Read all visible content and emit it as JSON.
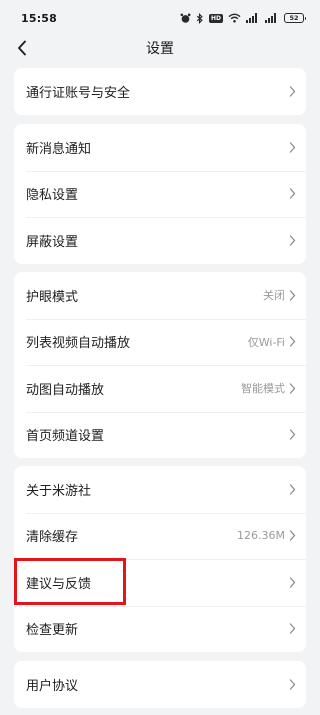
{
  "status_bar": {
    "time": "15:58",
    "hd_badge": "HD",
    "battery": "52"
  },
  "nav": {
    "title": "设置"
  },
  "groups": [
    {
      "items": [
        {
          "label": "通行证账号与安全",
          "value": ""
        }
      ]
    },
    {
      "items": [
        {
          "label": "新消息通知",
          "value": ""
        },
        {
          "label": "隐私设置",
          "value": ""
        },
        {
          "label": "屏蔽设置",
          "value": ""
        }
      ]
    },
    {
      "items": [
        {
          "label": "护眼模式",
          "value": "关闭"
        },
        {
          "label": "列表视频自动播放",
          "value": "仅Wi-Fi"
        },
        {
          "label": "动图自动播放",
          "value": "智能模式"
        },
        {
          "label": "首页频道设置",
          "value": ""
        }
      ]
    },
    {
      "items": [
        {
          "label": "关于米游社",
          "value": ""
        },
        {
          "label": "清除缓存",
          "value": "126.36M"
        },
        {
          "label": "建议与反馈",
          "value": ""
        },
        {
          "label": "检查更新",
          "value": ""
        }
      ]
    },
    {
      "items": [
        {
          "label": "用户协议",
          "value": ""
        }
      ]
    }
  ],
  "colors": {
    "background": "#f2f3f5",
    "card": "#ffffff",
    "highlight": "#e4141b"
  }
}
